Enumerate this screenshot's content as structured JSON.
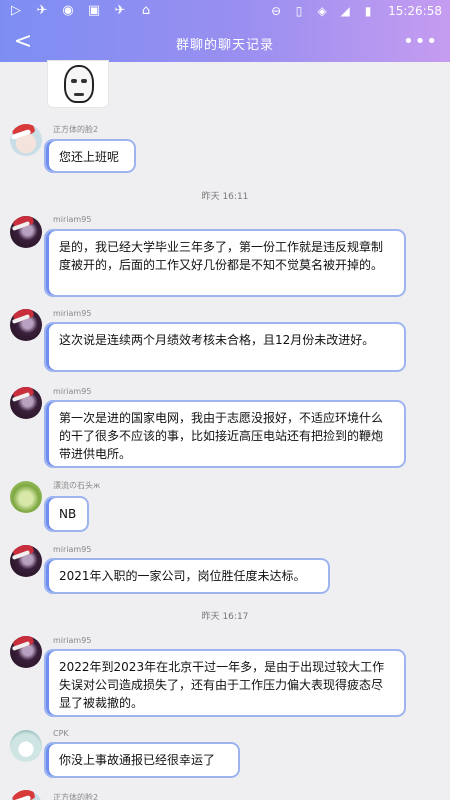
{
  "status_bar": {
    "time": "15:26:58",
    "left_icons": [
      "play-icon",
      "bird-icon",
      "game-icon",
      "image-icon",
      "bird-icon",
      "store-icon"
    ],
    "right_icons": [
      "minus-circle-icon",
      "phone-icon",
      "wifi-icon",
      "signal-icon",
      "battery-icon"
    ]
  },
  "header": {
    "title": "群聊的聊天记录",
    "back_label": "<",
    "more_label": "•••"
  },
  "messages": [
    {
      "sender": "正方体的脸2",
      "text": "您还上班呢"
    },
    {
      "timestamp": "昨天 16:11"
    },
    {
      "sender": "miriam95",
      "text": "是的，我已经大学毕业三年多了，第一份工作就是违反规章制度被开的，后面的工作又好几份都是不知不觉莫名被开掉的。"
    },
    {
      "sender": "miriam95",
      "text": "这次说是连续两个月绩效考核未合格，且12月份未改进好。"
    },
    {
      "sender": "miriam95",
      "text": "第一次是进的国家电网，我由于志愿没报好，不适应环境什么的干了很多不应该的事，比如接近高压电站还有把捡到的鞭炮带进供电所。"
    },
    {
      "sender": "漂流の石头ж",
      "text": "NB"
    },
    {
      "sender": "miriam95",
      "text": "2021年入职的一家公司，岗位胜任度未达标。"
    },
    {
      "timestamp": "昨天 16:17"
    },
    {
      "sender": "miriam95",
      "text": "2022年到2023年在北京干过一年多，是由于出现过较大工作失误对公司造成损失了，还有由于工作压力偏大表现得疲态尽显了被裁撤的。"
    },
    {
      "sender": "CPK",
      "text": "你没上事故通报已经很幸运了"
    },
    {
      "sender": "正方体的脸2"
    }
  ],
  "colors": {
    "header_gradient_start": "#7d8ef3",
    "header_gradient_end": "#c59cf0",
    "bubble_border": "#9eb4f0",
    "background": "#efeff2"
  }
}
